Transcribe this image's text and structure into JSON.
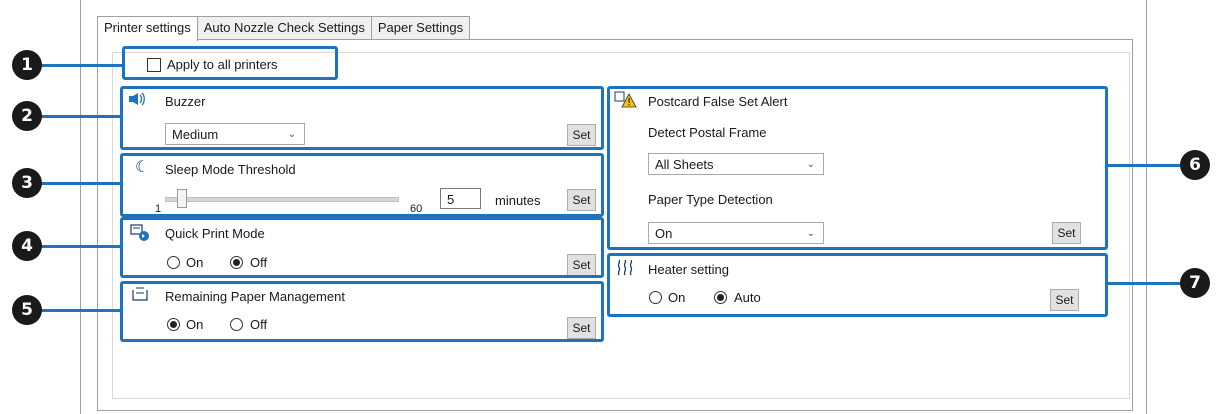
{
  "tabs": [
    "Printer settings",
    "Auto Nozzle Check Settings",
    "Paper Settings"
  ],
  "apply_all": {
    "label": "Apply to all printers",
    "checked": false
  },
  "buzzer": {
    "title": "Buzzer",
    "value": "Medium",
    "set": "Set"
  },
  "sleep": {
    "title": "Sleep Mode Threshold",
    "min_label": "1",
    "max_label": "60",
    "value": "5",
    "unit": "minutes",
    "set": "Set"
  },
  "quick_print": {
    "title": "Quick Print Mode",
    "on": "On",
    "off": "Off",
    "selected": "Off",
    "set": "Set"
  },
  "remaining_paper": {
    "title": "Remaining Paper Management",
    "on": "On",
    "off": "Off",
    "selected": "On",
    "set": "Set"
  },
  "postcard": {
    "title": "Postcard False Set Alert",
    "detect_label": "Detect Postal Frame",
    "detect_value": "All Sheets",
    "type_label": "Paper Type Detection",
    "type_value": "On",
    "set": "Set"
  },
  "heater": {
    "title": "Heater setting",
    "on": "On",
    "auto": "Auto",
    "selected": "Auto",
    "set": "Set"
  },
  "callouts": [
    "1",
    "2",
    "3",
    "4",
    "5",
    "6",
    "7"
  ],
  "colors": {
    "callout": "#1e73be",
    "badge": "#1a1a1a"
  }
}
